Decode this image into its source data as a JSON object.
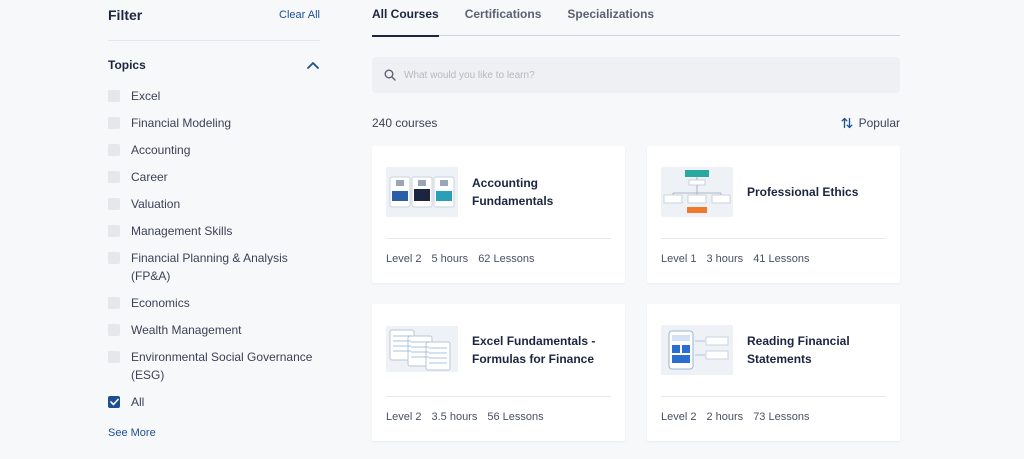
{
  "sidebar": {
    "title": "Filter",
    "clear_all": "Clear All",
    "topics_title": "Topics",
    "topics": [
      {
        "label": "Excel",
        "checked": false
      },
      {
        "label": "Financial Modeling",
        "checked": false
      },
      {
        "label": "Accounting",
        "checked": false
      },
      {
        "label": "Career",
        "checked": false
      },
      {
        "label": "Valuation",
        "checked": false
      },
      {
        "label": "Management Skills",
        "checked": false
      },
      {
        "label": "Financial Planning & Analysis (FP&A)",
        "checked": false
      },
      {
        "label": "Economics",
        "checked": false
      },
      {
        "label": "Wealth Management",
        "checked": false
      },
      {
        "label": "Environmental Social Governance (ESG)",
        "checked": false
      },
      {
        "label": "All",
        "checked": true
      }
    ],
    "see_more": "See More"
  },
  "tabs": [
    {
      "label": "All Courses",
      "active": true
    },
    {
      "label": "Certifications",
      "active": false
    },
    {
      "label": "Specializations",
      "active": false
    }
  ],
  "search": {
    "placeholder": "What would you like to learn?",
    "value": ""
  },
  "results": {
    "count_text": "240 courses",
    "sort_label": "Popular"
  },
  "courses": [
    {
      "title": "Accounting Fundamentals",
      "level": "Level 2",
      "duration": "5 hours",
      "lessons": "62 Lessons",
      "thumb": "accounting-thumbnail"
    },
    {
      "title": "Professional Ethics",
      "level": "Level 1",
      "duration": "3 hours",
      "lessons": "41 Lessons",
      "thumb": "ethics-flowchart-thumbnail"
    },
    {
      "title": "Excel Fundamentals - Formulas for Finance",
      "level": "Level 2",
      "duration": "3.5 hours",
      "lessons": "56 Lessons",
      "thumb": "excel-sheets-thumbnail"
    },
    {
      "title": "Reading Financial Statements",
      "level": "Level 2",
      "duration": "2 hours",
      "lessons": "73 Lessons",
      "thumb": "financial-statements-thumbnail"
    }
  ],
  "colors": {
    "accent": "#1d4f91",
    "text_dark": "#1b2540",
    "background": "#f7f8fa"
  }
}
